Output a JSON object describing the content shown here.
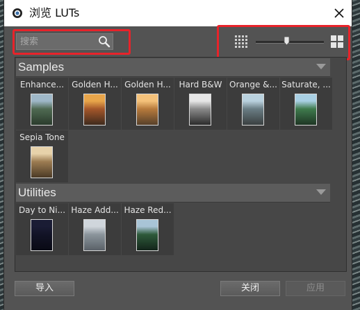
{
  "window": {
    "title": "浏览 LUTs"
  },
  "search": {
    "placeholder": "搜索"
  },
  "sections": [
    {
      "title": "Samples",
      "items": [
        {
          "label": "Enhance...",
          "palette": [
            "#9fb8c8",
            "#4f6a52",
            "#2a3b2c"
          ]
        },
        {
          "label": "Golden H...",
          "palette": [
            "#e8a54a",
            "#a4572a",
            "#3f2a1d"
          ]
        },
        {
          "label": "Golden H...",
          "palette": [
            "#f4c17a",
            "#b77a3c",
            "#57402a"
          ]
        },
        {
          "label": "Hard B&W",
          "palette": [
            "#e6e6e6",
            "#8a8a8a",
            "#2b2b2b"
          ]
        },
        {
          "label": "Orange &...",
          "palette": [
            "#b9d1de",
            "#6a7d84",
            "#3a3f40"
          ]
        },
        {
          "label": "Saturate, ...",
          "palette": [
            "#a9d0e4",
            "#3f7a4d",
            "#1e3524"
          ]
        },
        {
          "label": "Sepia Tone",
          "palette": [
            "#e7d2aa",
            "#9c7c52",
            "#4b3a25"
          ]
        }
      ]
    },
    {
      "title": "Utilities",
      "items": [
        {
          "label": "Day to Ni...",
          "palette": [
            "#1a1c34",
            "#121326",
            "#090a14"
          ]
        },
        {
          "label": "Haze Add...",
          "palette": [
            "#d0d6dc",
            "#8b959c",
            "#5a6168"
          ]
        },
        {
          "label": "Haze Red...",
          "palette": [
            "#a8c4d6",
            "#2e5a3a",
            "#13241a"
          ]
        }
      ]
    }
  ],
  "footer": {
    "import_label": "导入",
    "close_label": "关闭",
    "apply_label": "应用"
  },
  "colors": {
    "highlight": "#e8232a",
    "dialog_bg": "#535353",
    "panel_bg": "#474747",
    "tile_bg": "#3c3c3c"
  },
  "size_slider": {
    "value": 0.45
  }
}
